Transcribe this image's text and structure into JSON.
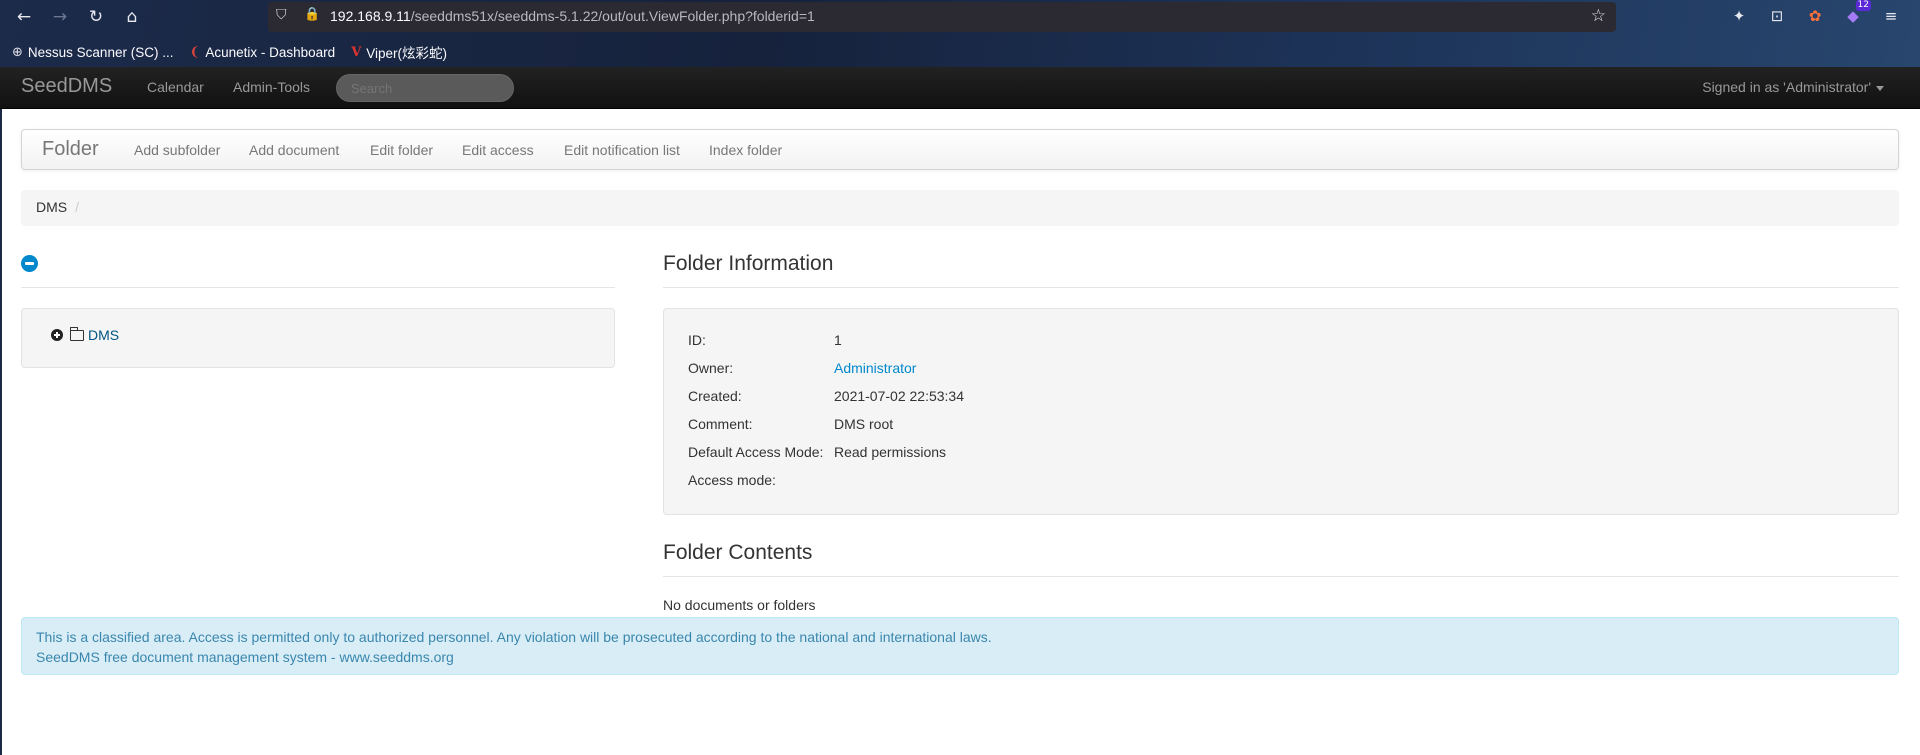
{
  "browser": {
    "url_host": "192.168.9.11",
    "url_path": "/seeddms51x/seeddms-5.1.22/out/out.ViewFolder.php?folderid=1",
    "extensions_badge": "12",
    "bookmarks": [
      {
        "label": "Nessus Scanner (SC) ...",
        "icon": "globe-icon"
      },
      {
        "label": "Acunetix - Dashboard",
        "icon": "acunetix-icon"
      },
      {
        "label": "Viper(炫彩蛇)",
        "icon": "viper-icon"
      }
    ],
    "icons": {
      "back": "←",
      "forward": "→",
      "reload": "↻",
      "home": "⌂",
      "shield": "⛉",
      "lock": "🔒",
      "star": "☆",
      "pocket": "✦",
      "save": "⊡",
      "ext": "✿",
      "menu": "≡"
    }
  },
  "navbar": {
    "brand": "SeedDMS",
    "calendar": "Calendar",
    "admin_tools": "Admin-Tools",
    "search_placeholder": "Search",
    "signed_in": "Signed in as 'Administrator'"
  },
  "folder_menu": {
    "title": "Folder",
    "add_subfolder": "Add subfolder",
    "add_document": "Add document",
    "edit_folder": "Edit folder",
    "edit_access": "Edit access",
    "edit_notification": "Edit notification list",
    "index_folder": "Index folder"
  },
  "breadcrumb": {
    "root": "DMS",
    "divider": "/"
  },
  "tree": {
    "root_label": "DMS"
  },
  "folder_info": {
    "heading": "Folder Information",
    "rows": [
      {
        "label": "ID:",
        "value": "1"
      },
      {
        "label": "Owner:",
        "value": "Administrator"
      },
      {
        "label": "Created:",
        "value": "2021-07-02 22:53:34"
      },
      {
        "label": "Comment:",
        "value": "DMS root"
      },
      {
        "label": "Default Access Mode:",
        "value": "Read permissions"
      },
      {
        "label": "Access mode:",
        "value": ""
      }
    ]
  },
  "folder_contents": {
    "heading": "Folder Contents",
    "empty_message": "No documents or folders"
  },
  "footer": {
    "line1": "This is a classified area. Access is permitted only to authorized personnel. Any violation will be prosecuted according to the national and international laws.",
    "line2": "SeedDMS free document management system - www.seeddms.org"
  }
}
